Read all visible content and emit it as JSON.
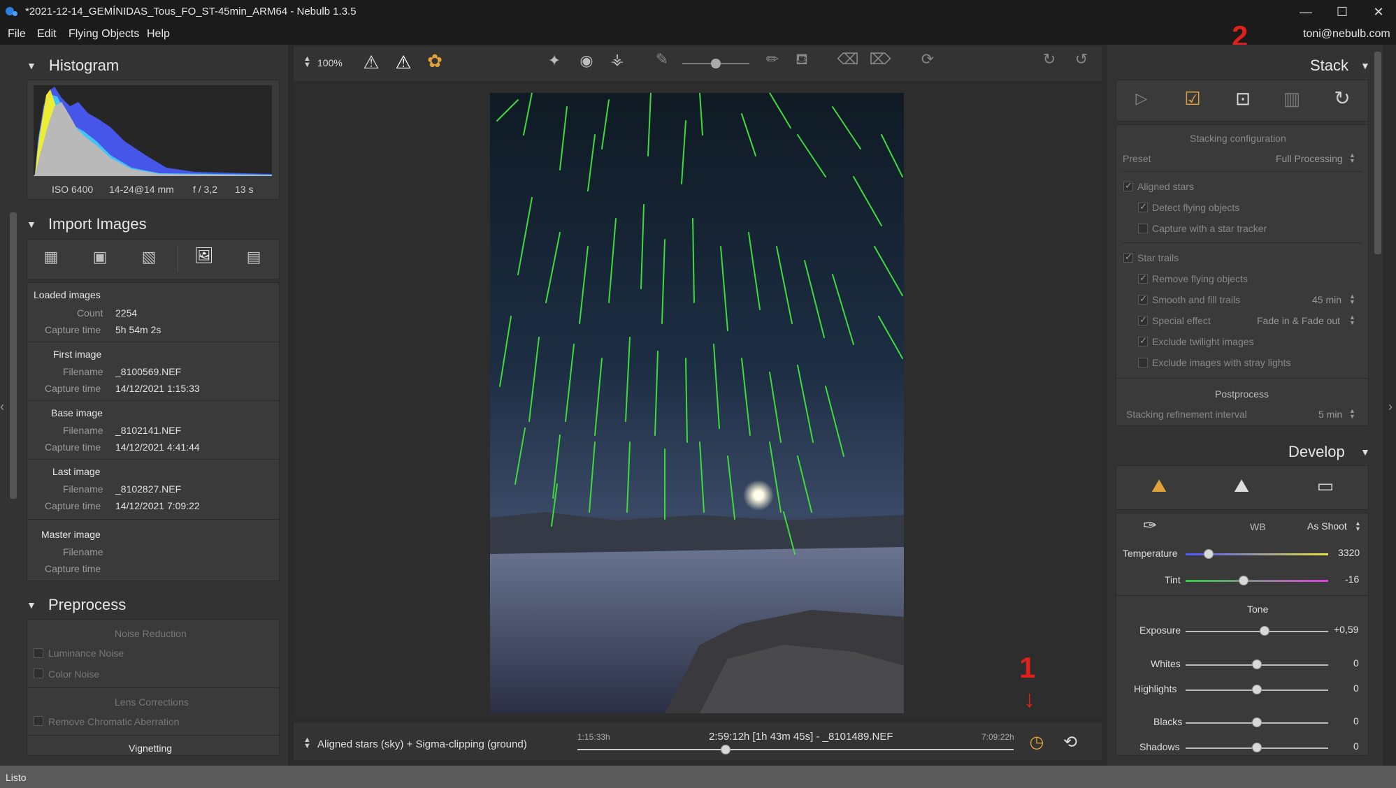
{
  "window": {
    "title": "*2021-12-14_GEMÍNIDAS_Tous_FO_ST-45min_ARM64 - Nebulb 1.3.5",
    "user": "toni@nebulb.com",
    "minimize": "—",
    "maximize": "☐",
    "close": "✕"
  },
  "menu": [
    "File",
    "Edit",
    "Flying Objects",
    "Help"
  ],
  "histogram": {
    "title": "Histogram",
    "iso": "ISO 6400",
    "lens": "14-24@14 mm",
    "aperture": "f / 3,2",
    "exposure": "13 s"
  },
  "import": {
    "title": "Import Images",
    "loaded": {
      "header": "Loaded images",
      "count_label": "Count",
      "count": "2254",
      "capture_label": "Capture time",
      "capture": "5h 54m 2s"
    },
    "first": {
      "header": "First image",
      "filename_label": "Filename",
      "filename": "_8100569.NEF",
      "capture_label": "Capture time",
      "capture": "14/12/2021 1:15:33"
    },
    "base": {
      "header": "Base image",
      "filename_label": "Filename",
      "filename": "_8102141.NEF",
      "capture_label": "Capture time",
      "capture": "14/12/2021 4:41:44"
    },
    "last": {
      "header": "Last image",
      "filename_label": "Filename",
      "filename": "_8102827.NEF",
      "capture_label": "Capture time",
      "capture": "14/12/2021 7:09:22"
    },
    "master": {
      "header": "Master image",
      "filename_label": "Filename",
      "capture_label": "Capture time"
    }
  },
  "preprocess": {
    "title": "Preprocess",
    "noise_header": "Noise Reduction",
    "luminance": "Luminance Noise",
    "color": "Color Noise",
    "lens_header": "Lens Corrections",
    "chromatic": "Remove Chromatic Aberration",
    "vignetting": "Vignetting"
  },
  "toolbar": {
    "zoom": "100%"
  },
  "bottom": {
    "mode": "Aligned stars (sky) + Sigma-clipping (ground)",
    "start_time": "1:15:33h",
    "current": "2:59:12h [1h 43m 45s] - _8101489.NEF",
    "end_time": "7:09:22h",
    "timeline_position": 0.34
  },
  "stack": {
    "title": "Stack",
    "config_header": "Stacking configuration",
    "preset_label": "Preset",
    "preset_value": "Full Processing",
    "aligned_stars": "Aligned stars",
    "detect_flying": "Detect flying objects",
    "capture_tracker": "Capture with a star tracker",
    "star_trails": "Star trails",
    "remove_flying": "Remove flying objects",
    "smooth_fill": "Smooth and fill trails",
    "smooth_value": "45 min",
    "special_effect": "Special effect",
    "special_value": "Fade in & Fade out",
    "exclude_twilight": "Exclude twilight images",
    "exclude_stray": "Exclude images with stray lights",
    "postprocess_header": "Postprocess",
    "refinement_label": "Stacking refinement interval",
    "refinement_value": "5 min"
  },
  "develop": {
    "title": "Develop",
    "wb_label": "WB",
    "wb_value": "As Shoot",
    "temperature_label": "Temperature",
    "temperature": "3320",
    "tint_label": "Tint",
    "tint": "-16",
    "tone_header": "Tone",
    "exposure_label": "Exposure",
    "exposure": "+0,59",
    "whites_label": "Whites",
    "whites": "0",
    "highlights_label": "Highlights",
    "highlights": "0",
    "blacks_label": "Blacks",
    "blacks": "0",
    "shadows_label": "Shadows",
    "shadows": "0"
  },
  "annotations": {
    "one": "1",
    "two": "2"
  },
  "status": "Listo",
  "colors": {
    "accent": "#e2a23a",
    "trails": "#3ddc3a",
    "annotation": "#e0201b"
  }
}
